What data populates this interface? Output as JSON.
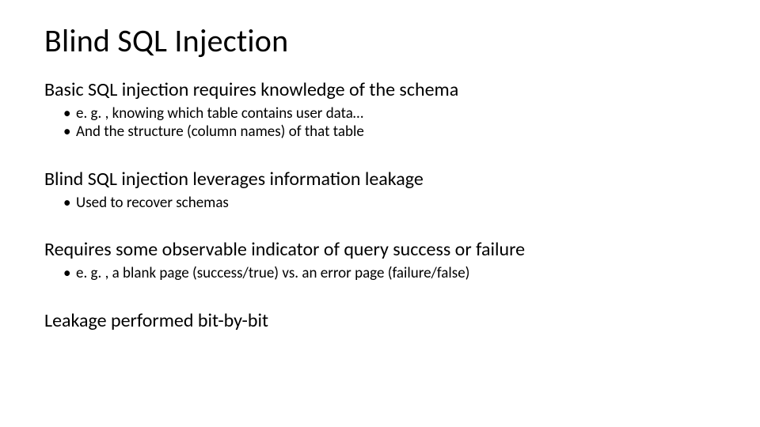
{
  "slide": {
    "title": "Blind SQL Injection",
    "sections": [
      {
        "heading": "Basic SQL injection requires knowledge of the schema",
        "bullets": [
          "e. g. , knowing which table contains user data…",
          "And the structure (column names) of that table"
        ]
      },
      {
        "heading": "Blind SQL injection leverages information leakage",
        "bullets": [
          "Used to recover schemas"
        ]
      },
      {
        "heading": "Requires some observable indicator of query success or failure",
        "bullets": [
          "e. g. , a blank page (success/true) vs. an error page (failure/false)"
        ]
      },
      {
        "heading": "Leakage performed bit-by-bit",
        "bullets": []
      }
    ]
  }
}
